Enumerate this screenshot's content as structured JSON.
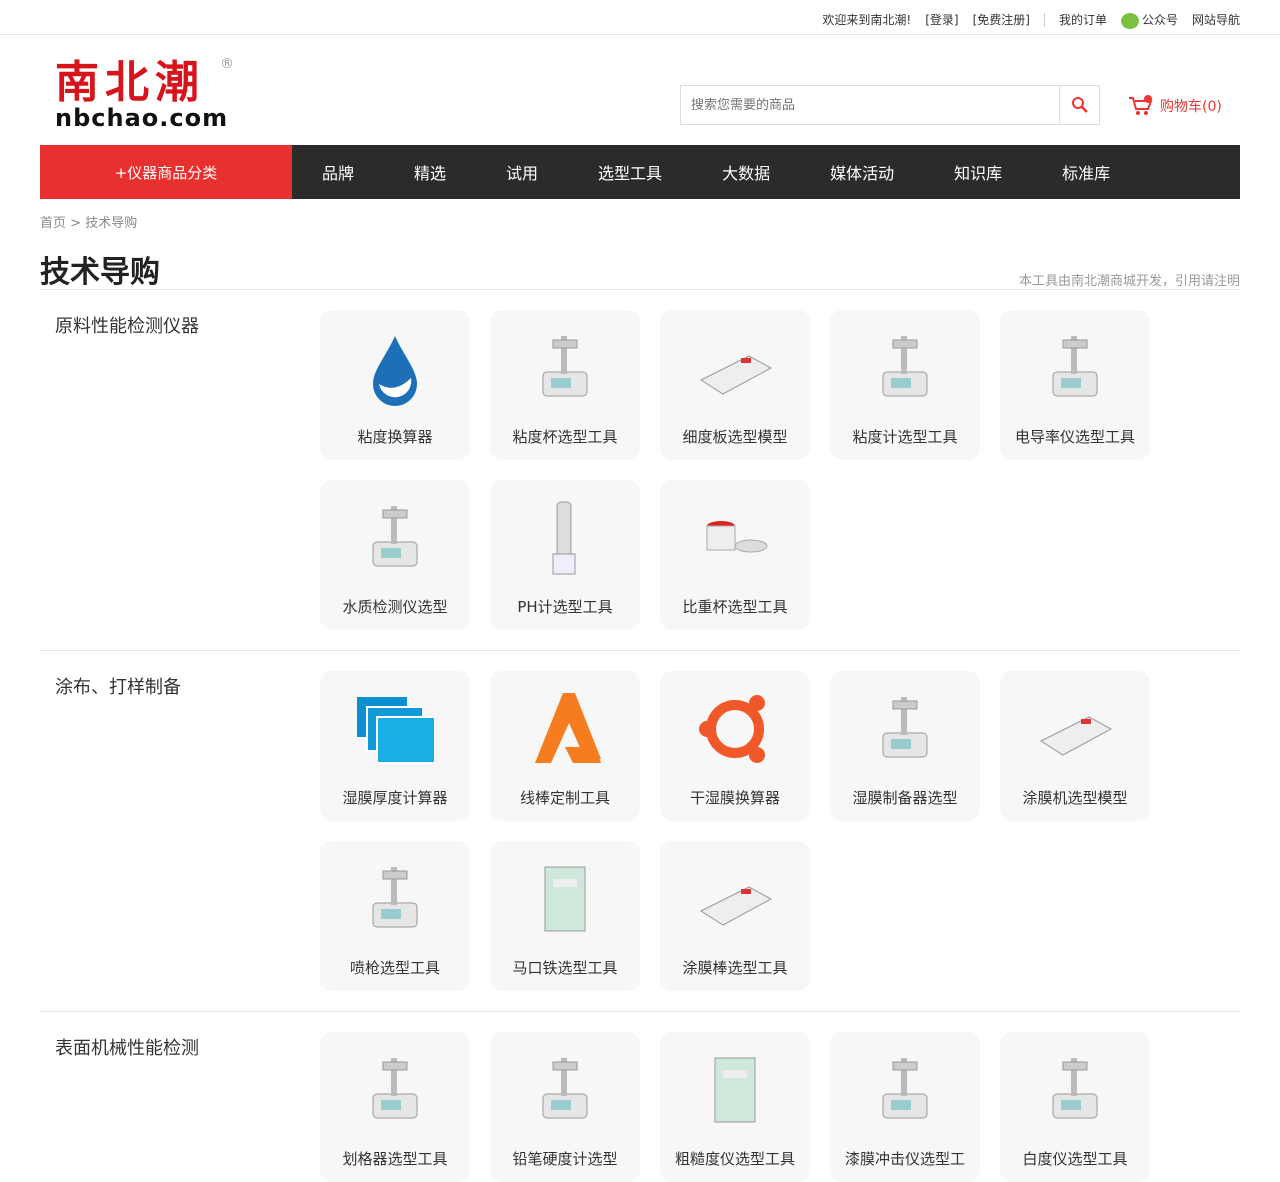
{
  "topbar": {
    "welcome": "欢迎来到南北潮!",
    "login": "[登录]",
    "register": "[免费注册]",
    "orders": "我的订单",
    "wechat": "公众号",
    "sitemap": "网站导航"
  },
  "logo": {
    "cn": "南北潮",
    "en": "nbchao.com",
    "reg": "®"
  },
  "search": {
    "placeholder": "搜索您需要的商品"
  },
  "cart": {
    "label": "购物车(0)"
  },
  "nav": {
    "category": "+仪器商品分类",
    "items": [
      "品牌",
      "精选",
      "试用",
      "选型工具",
      "大数据",
      "媒体活动",
      "知识库",
      "标准库"
    ]
  },
  "breadcrumb": {
    "home": "首页",
    "sep": ">",
    "current": "技术导购"
  },
  "page": {
    "title": "技术导购",
    "note": "本工具由南北潮商城开发，引用请注明"
  },
  "sections": [
    {
      "title": "原料性能检测仪器",
      "items": [
        {
          "label": "粘度换算器",
          "icon": "drop"
        },
        {
          "label": "粘度杯选型工具",
          "icon": "device"
        },
        {
          "label": "细度板选型模型",
          "icon": "plate"
        },
        {
          "label": "粘度计选型工具",
          "icon": "device"
        },
        {
          "label": "电导率仪选型工具",
          "icon": "device"
        },
        {
          "label": "水质检测仪选型",
          "icon": "device"
        },
        {
          "label": "PH计选型工具",
          "icon": "pen"
        },
        {
          "label": "比重杯选型工具",
          "icon": "cup"
        }
      ]
    },
    {
      "title": "涂布、打样制备",
      "items": [
        {
          "label": "湿膜厚度计算器",
          "icon": "squares"
        },
        {
          "label": "线棒定制工具",
          "icon": "letter-a"
        },
        {
          "label": "干湿膜换算器",
          "icon": "ring"
        },
        {
          "label": "湿膜制备器选型",
          "icon": "device"
        },
        {
          "label": "涂膜机选型模型",
          "icon": "plate"
        },
        {
          "label": "喷枪选型工具",
          "icon": "device"
        },
        {
          "label": "马口铁选型工具",
          "icon": "panel"
        },
        {
          "label": "涂膜棒选型工具",
          "icon": "plate"
        }
      ]
    },
    {
      "title": "表面机械性能检测",
      "items": [
        {
          "label": "划格器选型工具",
          "icon": "device"
        },
        {
          "label": "铅笔硬度计选型",
          "icon": "device"
        },
        {
          "label": "粗糙度仪选型工具",
          "icon": "panel"
        },
        {
          "label": "漆膜冲击仪选型工",
          "icon": "device"
        },
        {
          "label": "白度仪选型工具",
          "icon": "device"
        }
      ]
    }
  ]
}
